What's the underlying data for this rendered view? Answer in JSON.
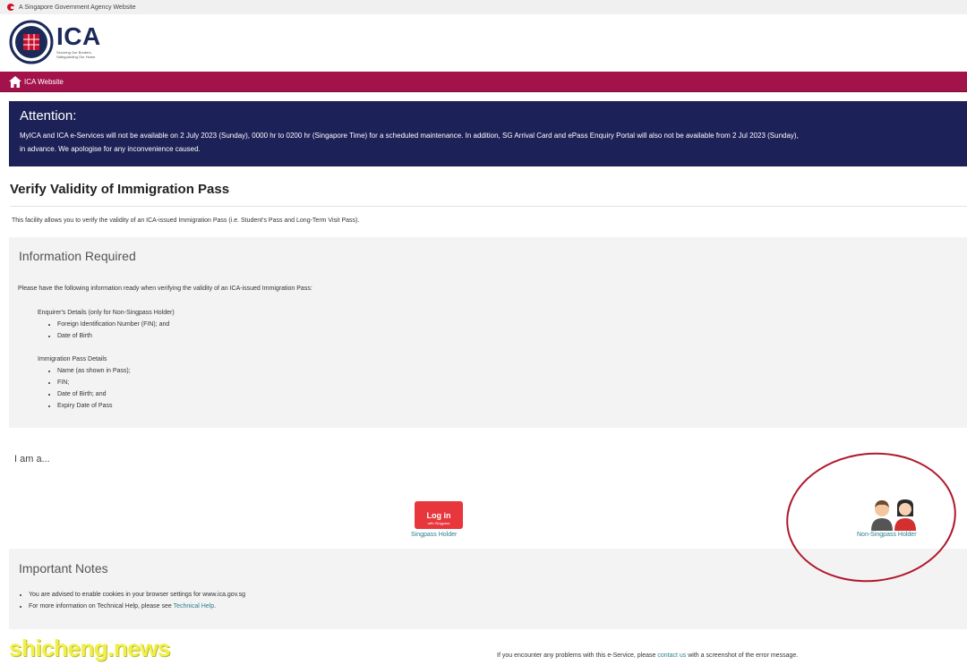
{
  "gov_bar": {
    "text": "A Singapore Government Agency Website"
  },
  "header": {
    "logo_word": "ICA",
    "logo_tagline": "Securing Our Borders, Safeguarding Our Home"
  },
  "navbar": {
    "home_link": "ICA Website"
  },
  "alert": {
    "title": "Attention:",
    "line1": "MyICA and ICA e-Services will not be available on 2 July 2023 (Sunday), 0000 hr to 0200 hr (Singapore Time) for a scheduled maintenance. In addition, SG Arrival Card and ePass Enquiry Portal will also not be available from 2 Jul 2023 (Sunday),",
    "line2": "in advance. We apologise for any inconvenience caused."
  },
  "page": {
    "title": "Verify Validity of Immigration Pass",
    "intro": "This facility allows you to verify the validity of an ICA-issued Immigration Pass (i.e. Student's Pass and Long-Term Visit Pass)."
  },
  "info": {
    "title": "Information Required",
    "lead": "Please have the following information ready when verifying the validity of an ICA-issued Immigration Pass:",
    "enquirer_heading": "Enquirer's Details (only for Non-Singpass Holder)",
    "enquirer_items": [
      "Foreign Identification Number (FIN); and",
      "Date of Birth"
    ],
    "pass_heading": "Immigration Pass Details",
    "pass_items": [
      "Name (as shown in Pass);",
      "FIN;",
      "Date of Birth; and",
      "Expiry Date of Pass"
    ]
  },
  "selector": {
    "prompt": "I am a...",
    "login_main": "Log in",
    "login_sub": "with Singpass",
    "singpass_label": "Singpass Holder",
    "nonsingpass_label": "Non-Singpass Holder"
  },
  "notes": {
    "title": "Important Notes",
    "item1": "You are advised to enable cookies in your browser settings for www.ica.gov.sg",
    "item2_prefix": "For more information on Technical Help, please see ",
    "item2_link": "Technical Help",
    "item2_suffix": "."
  },
  "footer": {
    "prefix": "If you encounter any problems with this e-Service, please ",
    "link": "contact us",
    "suffix": " with a screenshot of the error message."
  },
  "watermark": {
    "text": "shicheng.news"
  },
  "colors": {
    "navbar": "#a4124b",
    "alert_bg": "#1c2157",
    "login_button": "#e8363d",
    "link": "#2a7f8e",
    "annotation_circle": "#b0182a"
  }
}
